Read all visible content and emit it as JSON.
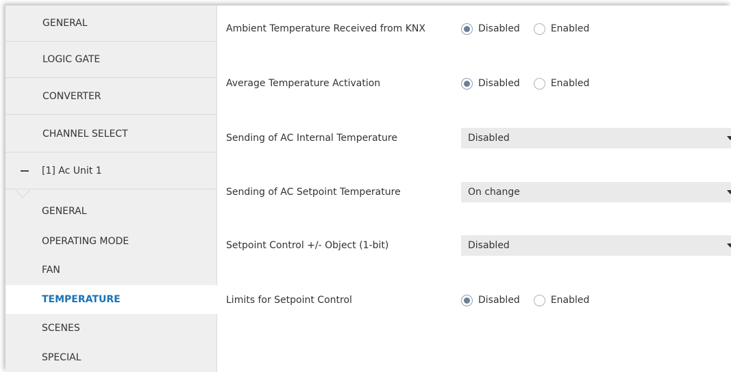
{
  "sidebar": {
    "items": [
      {
        "label": "GENERAL"
      },
      {
        "label": "LOGIC GATE"
      },
      {
        "label": "CONVERTER"
      },
      {
        "label": "CHANNEL SELECT"
      },
      {
        "label": "[1] Ac Unit 1"
      }
    ],
    "sub_items": [
      {
        "label": "GENERAL"
      },
      {
        "label": "OPERATING MODE"
      },
      {
        "label": "FAN"
      },
      {
        "label": "TEMPERATURE"
      },
      {
        "label": "SCENES"
      },
      {
        "label": "SPECIAL"
      }
    ],
    "active_sub_item": "TEMPERATURE",
    "accent_color": "#1a73b8"
  },
  "params": [
    {
      "label": "Ambient Temperature Received from KNX",
      "type": "radio",
      "options": [
        "Disabled",
        "Enabled"
      ],
      "selected": "Disabled"
    },
    {
      "label": "Average Temperature Activation",
      "type": "radio",
      "options": [
        "Disabled",
        "Enabled"
      ],
      "selected": "Disabled"
    },
    {
      "label": "Sending of AC Internal Temperature",
      "type": "select",
      "value": "Disabled"
    },
    {
      "label": "Sending of AC Setpoint Temperature",
      "type": "select",
      "value": "On change"
    },
    {
      "label": "Setpoint Control +/- Object (1-bit)",
      "type": "select",
      "value": "Disabled"
    },
    {
      "label": "Limits for Setpoint Control",
      "type": "radio",
      "options": [
        "Disabled",
        "Enabled"
      ],
      "selected": "Disabled"
    }
  ]
}
